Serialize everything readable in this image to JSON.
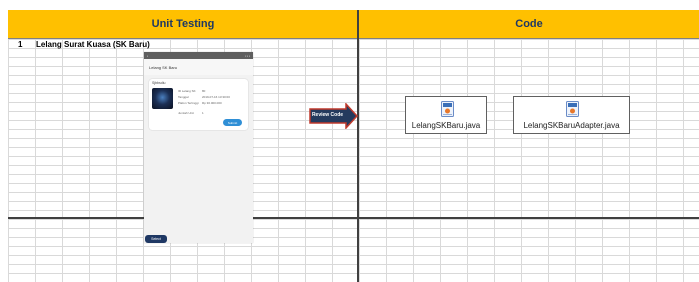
{
  "headers": {
    "unit_testing": "Unit Testing",
    "code": "Code"
  },
  "row": {
    "number": "1",
    "title": "Lelang Surat Kuasa (SK Baru)"
  },
  "phone": {
    "app_title": "Lelang SK Baru",
    "card_title": "Sjbbsdiu",
    "fields": [
      {
        "label": "ID Lelang SK",
        "value": "80"
      },
      {
        "label": "Tanggal",
        "value": "2019-07-16 13:30:00"
      },
      {
        "label": "Plafon Tertinggi",
        "value": "Rp 30.000.000"
      },
      {
        "label": "Jumlah Unit",
        "value": "1"
      }
    ],
    "submit_label": "Submit",
    "select_label": "Select"
  },
  "arrow": {
    "label": "Review Code",
    "fill_color": "#243a5e",
    "border_color": "#c0392b"
  },
  "files": [
    {
      "name": "LelangSKBaru.java",
      "icon": "java-file-icon"
    },
    {
      "name": "LelangSKBaruAdapter.java",
      "icon": "java-file-icon"
    }
  ],
  "colors": {
    "header_bg": "#ffc000",
    "header_text": "#1f3864",
    "submit_button": "#2f8fd6"
  }
}
